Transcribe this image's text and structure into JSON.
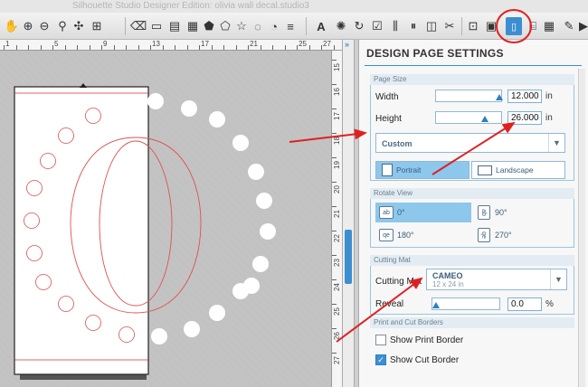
{
  "window": {
    "title": "Silhouette Studio Designer Edition: olivia wall decal.studio3"
  },
  "toolbar": {
    "icons": [
      "pan-icon",
      "zoom-in-icon",
      "zoom-out-icon",
      "zoom-select-icon",
      "fit-page-icon",
      "eraser-icon",
      "fill-color-icon",
      "line-color-icon",
      "fill-pattern-icon",
      "shape-pentagon-icon",
      "shape-hex-icon",
      "shape-star-icon",
      "shape-rounded-icon",
      "shape-freeform-icon",
      "text-icon",
      "replicate-icon",
      "rotate-icon",
      "modify-icon",
      "align-icon",
      "offset-icon",
      "grid-icon",
      "page-setup-icon",
      "trace-icon",
      "cut-settings-icon",
      "send-icon"
    ],
    "text_tool_label": "A"
  },
  "ruler": {
    "h_labels": [
      "1",
      "2",
      "3",
      "4",
      "5",
      "6",
      "7",
      "8",
      "9",
      "10",
      "11",
      "12",
      "13",
      "14",
      "15",
      "16",
      "17",
      "18",
      "19",
      "20",
      "21",
      "22",
      "23",
      "24",
      "25",
      "26",
      "27"
    ],
    "v_labels": [
      "15",
      "16",
      "17",
      "18",
      "19",
      "20",
      "21",
      "22",
      "23",
      "24",
      "25",
      "26",
      "27"
    ]
  },
  "panel": {
    "title": "DESIGN PAGE SETTINGS",
    "page_size_section": "Page Size",
    "width_label": "Width",
    "width_value": "12.000",
    "width_unit": "in",
    "height_label": "Height",
    "height_value": "26.000",
    "height_unit": "in",
    "page_size_select": "Custom",
    "portrait_label": "Portrait",
    "landscape_label": "Landscape",
    "rotate_section": "Rotate View",
    "rotate_options": [
      {
        "box": "ab",
        "label": "0°"
      },
      {
        "box": "ab",
        "label": "90°"
      },
      {
        "box": "qe",
        "label": "180°"
      },
      {
        "box": "qe",
        "label": "270°"
      }
    ],
    "cutting_mat_section": "Cutting Mat",
    "cutting_mat_label": "Cutting Mat",
    "cutting_mat_value": "CAMEO",
    "cutting_mat_sub": "12 x 24 in",
    "reveal_label": "Reveal",
    "reveal_value": "0.0",
    "reveal_unit": "%",
    "borders_section": "Print and Cut Borders",
    "show_print_border": "Show Print Border",
    "show_cut_border": "Show Cut Border",
    "show_print_border_checked": false,
    "show_cut_border_checked": true
  },
  "colors": {
    "accent": "#3b8fd1",
    "annotation_red": "#e02020",
    "design_line": "#e05050"
  }
}
